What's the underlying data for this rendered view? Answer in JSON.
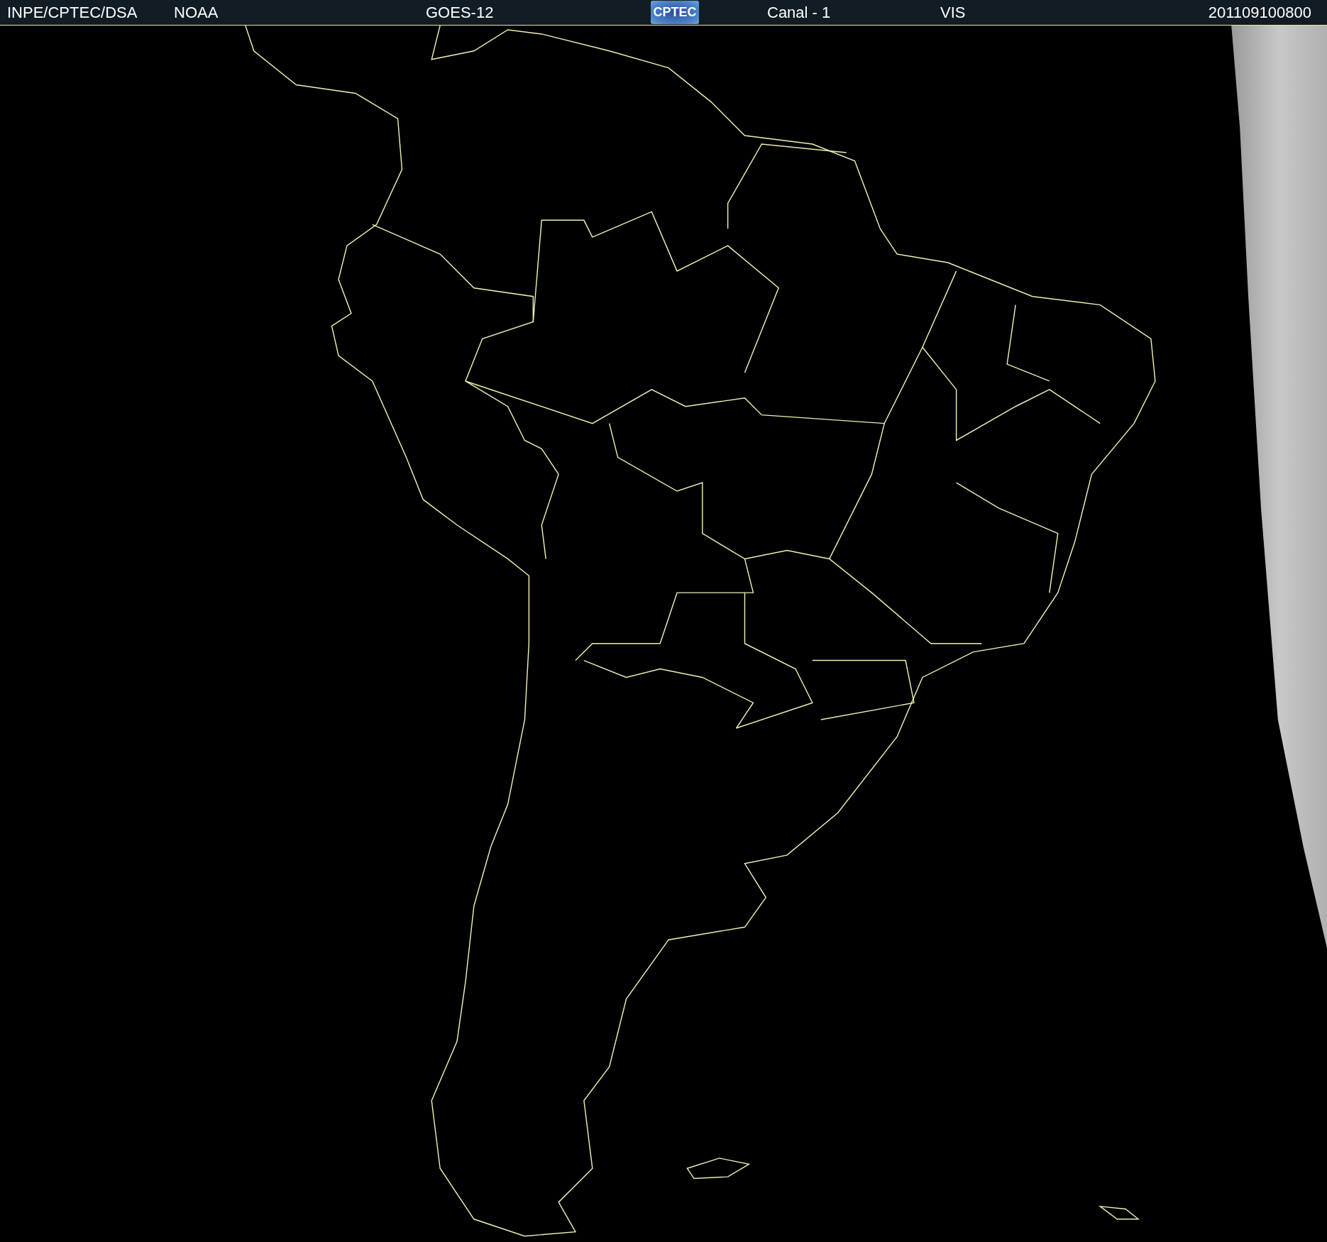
{
  "header": {
    "items": [
      {
        "kind": "text",
        "text": "INPE/CPTEC/DSA"
      },
      {
        "kind": "text",
        "text": "NOAA"
      },
      {
        "kind": "text",
        "text": "GOES-12"
      },
      {
        "kind": "logo",
        "text": "CPTEC"
      },
      {
        "kind": "text",
        "text": "Canal - 1"
      },
      {
        "kind": "text",
        "text": "VIS"
      },
      {
        "kind": "text",
        "text": "201109100800"
      }
    ]
  }
}
